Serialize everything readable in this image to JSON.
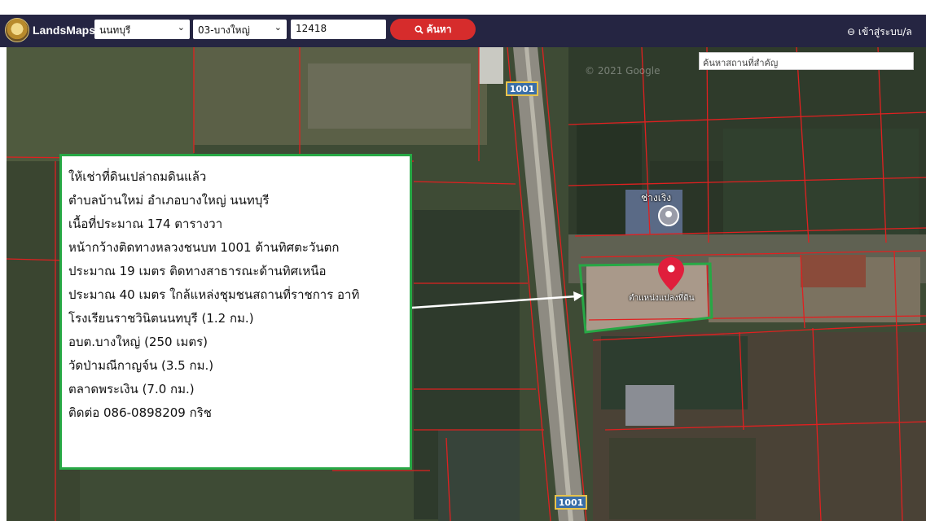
{
  "app": {
    "brand": "LandsMaps"
  },
  "search": {
    "province": "นนทบุรี",
    "district": "03-บางใหญ่",
    "parcel_number": "12418",
    "button_label": "ค้นหา"
  },
  "account": {
    "login_label": "เข้าสู่ระบบ/ล"
  },
  "map": {
    "poi_search_placeholder": "ค้นหาสถานที่สำคัญ",
    "route_shield_top": "1001",
    "route_shield_bottom": "1001",
    "place_label": "ช่างเริง",
    "plot_label": "ตำแหน่งแปลงที่ดิน",
    "imagery_credit": "© 2021 Google",
    "accent_colors": {
      "parcel_lines": "#e02020",
      "highlight": "#27a845",
      "pin": "#e01e3c"
    }
  },
  "listing": {
    "lines": [
      "ให้เช่าที่ดินเปล่าถมดินแล้ว",
      "ตำบลบ้านใหม่ อำเภอบางใหญ่ นนทบุรี",
      "เนื้อที่ประมาณ 174 ตารางวา",
      "หน้ากว้างติดทางหลวงชนบท 1001 ด้านทิศตะวันตก",
      "ประมาณ 19 เมตร ติดทางสาธารณะด้านทิศเหนือ",
      "ประมาณ 40 เมตร ใกล้แหล่งชุมชนสถานที่ราชการ  อาทิ",
      "โรงเรียนราชวินิตนนทบุรี (1.2 กม.)",
      "อบต.บางใหญ่ (250 เมตร)",
      "วัดป่ามณีกาญจ์น (3.5 กม.)",
      "ตลาดพระเงิน (7.0 กม.)",
      "ติดต่อ 086-0898209 กริช"
    ]
  }
}
